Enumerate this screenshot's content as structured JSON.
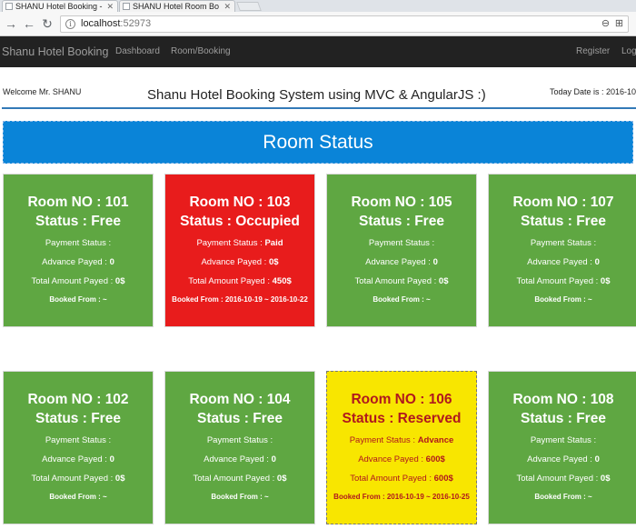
{
  "browser": {
    "tabs": [
      {
        "title": "SHANU Hotel Booking -",
        "active": true
      },
      {
        "title": "SHANU Hotel Room Bo",
        "active": false
      }
    ],
    "url_host": "localhost",
    "url_port": ":52973"
  },
  "navbar": {
    "brand": "Shanu Hotel Booking",
    "links": [
      "Dashboard",
      "Room/Booking"
    ],
    "right_links": [
      "Register",
      "Log"
    ]
  },
  "header": {
    "welcome": "Welcome Mr. SHANU",
    "title": "Shanu Hotel Booking System using MVC & AngularJS :)",
    "today": "Today Date is : 2016-10"
  },
  "banner": {
    "title": "Room Status"
  },
  "labels": {
    "room_prefix": "Room NO : ",
    "status_prefix": "Status : ",
    "payment_status": "Payment Status : ",
    "advance_payed": "Advance Payed : ",
    "total_payed": "Total Amount Payed : ",
    "booked_from": "Booked From : "
  },
  "rooms": [
    {
      "no": "101",
      "status": "Free",
      "payment": "",
      "advance": "0",
      "total": "0$",
      "booked": "~"
    },
    {
      "no": "103",
      "status": "Occupied",
      "payment": "Paid",
      "advance": "0$",
      "total": "450$",
      "booked": "2016-10-19 ~ 2016-10-22"
    },
    {
      "no": "105",
      "status": "Free",
      "payment": "",
      "advance": "0",
      "total": "0$",
      "booked": "~"
    },
    {
      "no": "107",
      "status": "Free",
      "payment": "",
      "advance": "0",
      "total": "0$",
      "booked": "~"
    },
    {
      "no": "102",
      "status": "Free",
      "payment": "",
      "advance": "0",
      "total": "0$",
      "booked": "~"
    },
    {
      "no": "104",
      "status": "Free",
      "payment": "",
      "advance": "0",
      "total": "0$",
      "booked": "~"
    },
    {
      "no": "106",
      "status": "Reserved",
      "payment": "Advance",
      "advance": "600$",
      "total": "600$",
      "booked": "2016-10-19 ~ 2016-10-25"
    },
    {
      "no": "108",
      "status": "Free",
      "payment": "",
      "advance": "0",
      "total": "0$",
      "booked": "~"
    }
  ],
  "colors": {
    "free": "#5fa742",
    "occupied": "#e81c1c",
    "reserved": "#f8e600",
    "reserved_text": "#b0181e",
    "banner": "#0a84d8",
    "navbar": "#222222"
  }
}
